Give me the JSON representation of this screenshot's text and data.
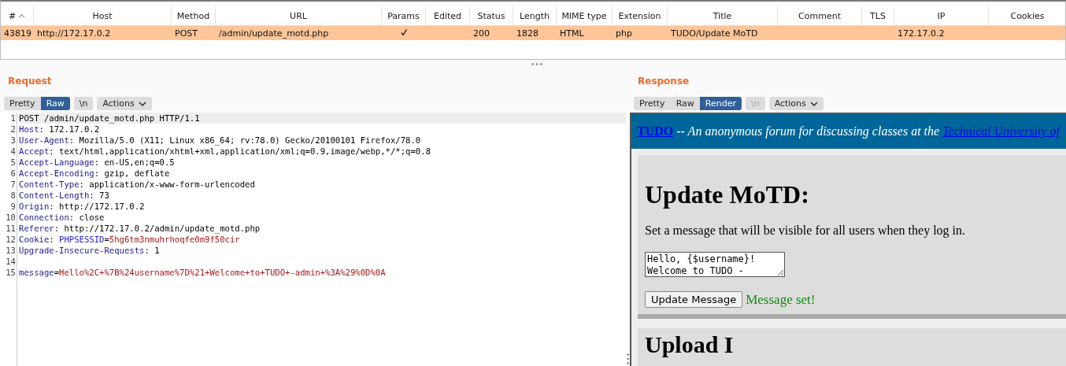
{
  "history_table": {
    "columns": [
      {
        "label": "#",
        "sorted": true
      },
      {
        "label": "Host",
        "sorted": false
      },
      {
        "label": "Method",
        "sorted": false
      },
      {
        "label": "URL",
        "sorted": false
      },
      {
        "label": "Params",
        "sorted": false
      },
      {
        "label": "Edited",
        "sorted": false
      },
      {
        "label": "Status",
        "sorted": false
      },
      {
        "label": "Length",
        "sorted": false
      },
      {
        "label": "MIME type",
        "sorted": false
      },
      {
        "label": "Extension",
        "sorted": false
      },
      {
        "label": "Title",
        "sorted": false
      },
      {
        "label": "Comment",
        "sorted": false
      },
      {
        "label": "TLS",
        "sorted": false
      },
      {
        "label": "IP",
        "sorted": false
      },
      {
        "label": "Cookies",
        "sorted": false
      }
    ],
    "rows": [
      {
        "selected": true,
        "params": true,
        "cells": [
          "43819",
          "http://172.17.0.2",
          "POST",
          "/admin/update_motd.php",
          "",
          "",
          "200",
          "1828",
          "HTML",
          "php",
          "TUDO/Update MoTD",
          "",
          "",
          "172.17.0.2",
          ""
        ]
      }
    ]
  },
  "request": {
    "title": "Request",
    "view_tabs": [
      {
        "label": "Pretty",
        "selected": false,
        "disabled": false
      },
      {
        "label": "Raw",
        "selected": true,
        "disabled": false
      }
    ],
    "newline_toggle": {
      "label": "\\n",
      "disabled": false
    },
    "actions": {
      "label": "Actions"
    },
    "lines": [
      {
        "number": "1",
        "selected": true,
        "segments": [
          {
            "kind": "plain",
            "text": "POST /admin/update_motd.php HTTP/1.1"
          }
        ]
      },
      {
        "number": "2",
        "selected": false,
        "segments": [
          {
            "kind": "name",
            "text": "Host"
          },
          {
            "kind": "plain",
            "text": ": 172.17.0.2"
          }
        ]
      },
      {
        "number": "3",
        "selected": false,
        "segments": [
          {
            "kind": "name",
            "text": "User-Agent"
          },
          {
            "kind": "plain",
            "text": ": Mozilla/5.0 (X11; Linux x86_64; rv:78.0) Gecko/20100101 Firefox/78.0"
          }
        ]
      },
      {
        "number": "4",
        "selected": false,
        "segments": [
          {
            "kind": "name",
            "text": "Accept"
          },
          {
            "kind": "plain",
            "text": ": text/html,application/xhtml+xml,application/xml;q=0.9,image/webp,*/*;q=0.8"
          }
        ]
      },
      {
        "number": "5",
        "selected": false,
        "segments": [
          {
            "kind": "name",
            "text": "Accept-Language"
          },
          {
            "kind": "plain",
            "text": ": en-US,en;q=0.5"
          }
        ]
      },
      {
        "number": "6",
        "selected": false,
        "segments": [
          {
            "kind": "name",
            "text": "Accept-Encoding"
          },
          {
            "kind": "plain",
            "text": ": gzip, deflate"
          }
        ]
      },
      {
        "number": "7",
        "selected": false,
        "segments": [
          {
            "kind": "name",
            "text": "Content-Type"
          },
          {
            "kind": "plain",
            "text": ": application/x-www-form-urlencoded"
          }
        ]
      },
      {
        "number": "8",
        "selected": false,
        "segments": [
          {
            "kind": "name",
            "text": "Content-Length"
          },
          {
            "kind": "plain",
            "text": ": 73"
          }
        ]
      },
      {
        "number": "9",
        "selected": false,
        "segments": [
          {
            "kind": "name",
            "text": "Origin"
          },
          {
            "kind": "plain",
            "text": ": http://172.17.0.2"
          }
        ]
      },
      {
        "number": "10",
        "selected": false,
        "segments": [
          {
            "kind": "name",
            "text": "Connection"
          },
          {
            "kind": "plain",
            "text": ": close"
          }
        ]
      },
      {
        "number": "11",
        "selected": false,
        "segments": [
          {
            "kind": "name",
            "text": "Referer"
          },
          {
            "kind": "plain",
            "text": ": http://172.17.0.2/admin/update_motd.php"
          }
        ]
      },
      {
        "number": "12",
        "selected": false,
        "segments": [
          {
            "kind": "name",
            "text": "Cookie"
          },
          {
            "kind": "plain",
            "text": ": "
          },
          {
            "kind": "key",
            "text": "PHPSESSID"
          },
          {
            "kind": "plain",
            "text": "="
          },
          {
            "kind": "value",
            "text": "5hg6tm3nmuhrhoqfe0m9f50cir"
          }
        ]
      },
      {
        "number": "13",
        "selected": false,
        "segments": [
          {
            "kind": "name",
            "text": "Upgrade-Insecure-Requests"
          },
          {
            "kind": "plain",
            "text": ": 1"
          }
        ]
      },
      {
        "number": "14",
        "selected": false
      },
      {
        "number": "15",
        "selected": false,
        "segments": [
          {
            "kind": "name",
            "text": "message"
          },
          {
            "kind": "plain",
            "text": "="
          },
          {
            "kind": "value",
            "text": "Hello%2C+%7B%24username%7D%21+Welcome+to+TUDO+-admin+%3A%29%0D%0A"
          }
        ]
      }
    ]
  },
  "response": {
    "title": "Response",
    "view_tabs": [
      {
        "label": "Pretty",
        "selected": false,
        "disabled": false
      },
      {
        "label": "Raw",
        "selected": false,
        "disabled": false
      },
      {
        "label": "Render",
        "selected": true,
        "disabled": false
      }
    ],
    "newline_toggle": {
      "label": "\\n",
      "disabled": true
    },
    "actions": {
      "label": "Actions"
    },
    "render": {
      "banner": {
        "site_link": "TUDO",
        "tagline": " -- An anonymous forum for discussing classes at the ",
        "university_link": "Technical University of"
      },
      "heading": "Update MoTD:",
      "description": "Set a message that will be visible for all users when they log in.",
      "message_value": "Hello, {$username}!\nWelcome to TUDO -",
      "submit_button": "Update Message",
      "status": "Message set!",
      "next_heading": "Upload I"
    }
  }
}
